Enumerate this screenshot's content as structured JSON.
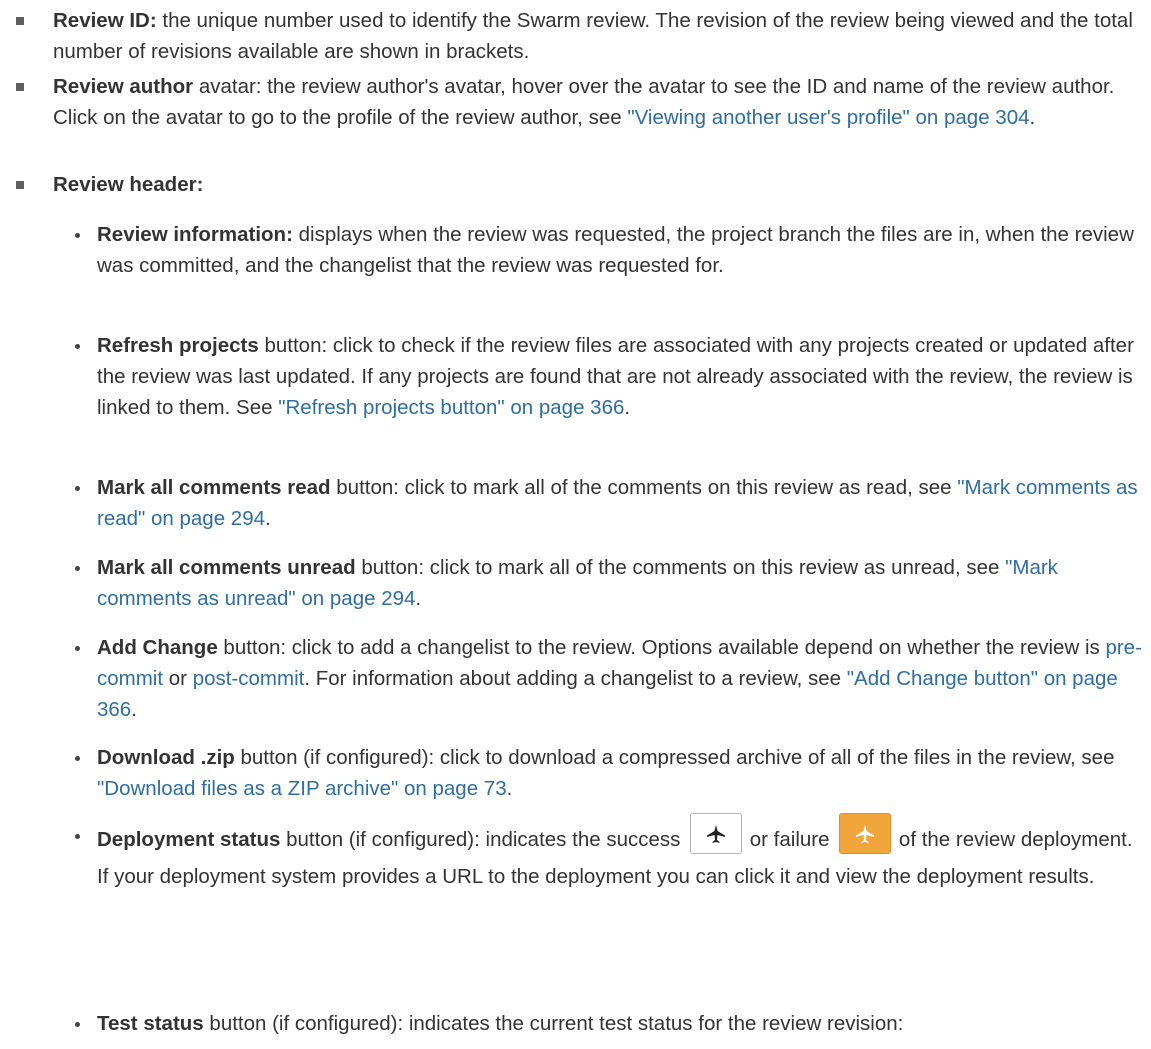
{
  "review_id": {
    "term": "Review ID:",
    "text": " the unique number used to identify the Swarm review. The revision of the review being viewed and the total number of revisions available are shown in brackets."
  },
  "review_author": {
    "term": "Review author",
    "text_a": " avatar: the review author's avatar, hover over the avatar to see the ID and name of the review author. Click on the avatar to go to the profile of the review author, see ",
    "link": "\"Viewing another user's profile\" on page 304",
    "text_b": "."
  },
  "review_header": {
    "term": "Review header:"
  },
  "review_information": {
    "term": "Review information:",
    "text": " displays when the review was requested, the project branch the files are in, when the review was committed, and the changelist that the review was requested for."
  },
  "refresh_projects": {
    "term": "Refresh projects",
    "text_a": " button: click to check if the review files are associated with any projects created or updated after the review was last updated. If any projects are found that are not already associated with the review, the review is linked to them. See ",
    "link": "\"Refresh projects button\" on page 366",
    "text_b": "."
  },
  "mark_read": {
    "term": "Mark all comments read",
    "text_a": " button: click to mark all of the comments on this review as read, see ",
    "link": "\"Mark comments as read\" on page 294",
    "text_b": "."
  },
  "mark_unread": {
    "term": "Mark all comments unread",
    "text_a": " button: click to mark all of the comments on this review as unread, see ",
    "link": "\"Mark comments as unread\" on page 294",
    "text_b": "."
  },
  "add_change": {
    "term": "Add Change",
    "text_a": " button: click to add a changelist to the review. Options available depend on whether the review is ",
    "link_pre": "pre-commit",
    "text_or": " or ",
    "link_post": "post-commit",
    "text_b": ". For information about adding a changelist to a review, see ",
    "link": "\"Add Change button\" on page 366",
    "text_c": "."
  },
  "download_zip": {
    "term": "Download .zip",
    "text_a": " button (if configured): click to download a compressed archive of all of the files in the review, see ",
    "link": "\"Download files as a ZIP archive\" on page 73",
    "text_b": "."
  },
  "deployment_status": {
    "term": "Deployment status",
    "text_a": " button (if configured): indicates the success ",
    "text_or": " or failure ",
    "text_b": " of the review deployment. If your deployment system provides a URL to the deployment you can click it and view the deployment results.",
    "success_icon": "airplane-icon",
    "failure_icon": "airplane-icon",
    "colors": {
      "failure_bg": "#f0a63a",
      "success_bg": "#ffffff"
    }
  },
  "test_status": {
    "term": "Test status",
    "text": " button (if configured): indicates the current test status for the review revision:"
  },
  "colors": {
    "link": "#2e6da4",
    "text": "#333333"
  }
}
